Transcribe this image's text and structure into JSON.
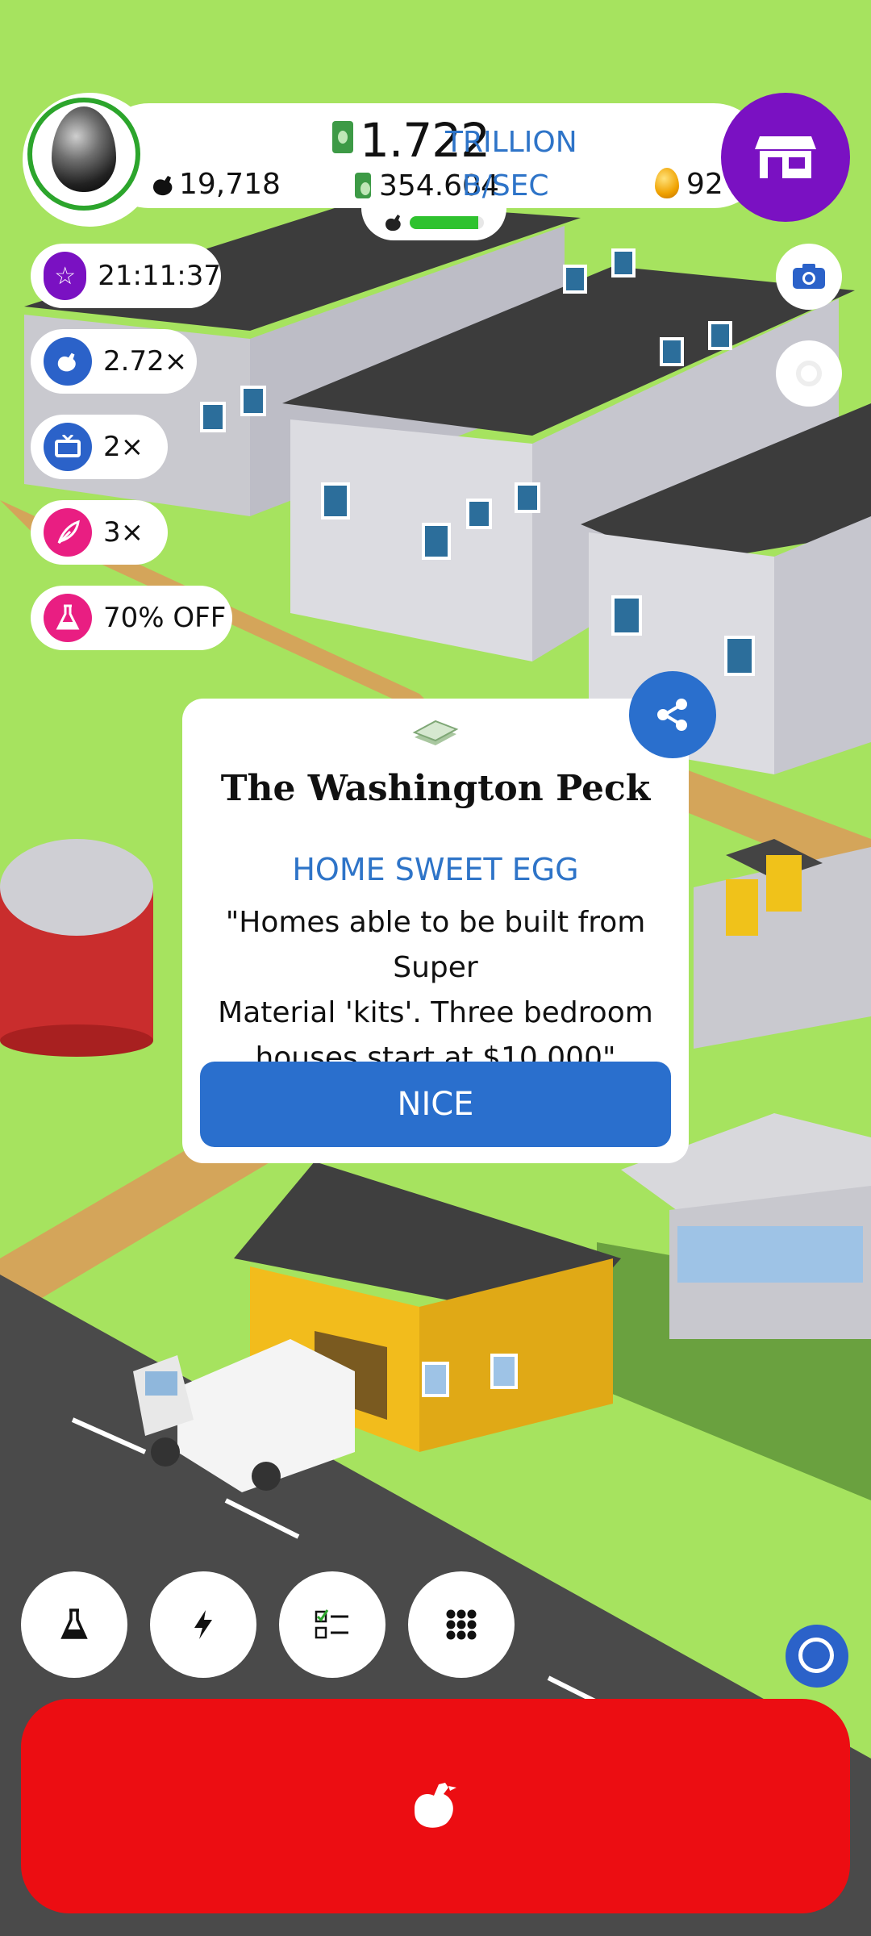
{
  "hud": {
    "cash_value": "1.722",
    "cash_unit": "TRILLION",
    "chicken_count": "19,718",
    "rate_value": "354.604",
    "rate_unit": "B/SEC",
    "golden_eggs": "92",
    "progress_fraction": 0.92
  },
  "boosts": [
    {
      "icon": "star-icon",
      "color": "#7a11c2",
      "label": "21:11:37"
    },
    {
      "icon": "chicken-icon",
      "color": "#2b62c9",
      "label": "2.72×"
    },
    {
      "icon": "tv-icon",
      "color": "#2b62c9",
      "label": "2×"
    },
    {
      "icon": "feather-icon",
      "color": "#e91e82",
      "label": "3×"
    },
    {
      "icon": "flask-icon",
      "color": "#e91e82",
      "label": "70% OFF"
    }
  ],
  "dialog": {
    "newspaper": "The Washington Peck",
    "headline": "HOME SWEET EGG",
    "body_lines": [
      "\"Homes able to be built from Super",
      "Material 'kits'. Three bedroom",
      "houses start at $10,000\""
    ],
    "button": "NICE"
  },
  "colors": {
    "grass": "#a6e35f",
    "shop_purple": "#7a11c2",
    "accent_blue": "#2a6fcd",
    "hatch_red": "#ec0d12"
  },
  "toolbar_icons": [
    "flask-icon",
    "lightning-icon",
    "checklist-icon",
    "grid-icon"
  ]
}
